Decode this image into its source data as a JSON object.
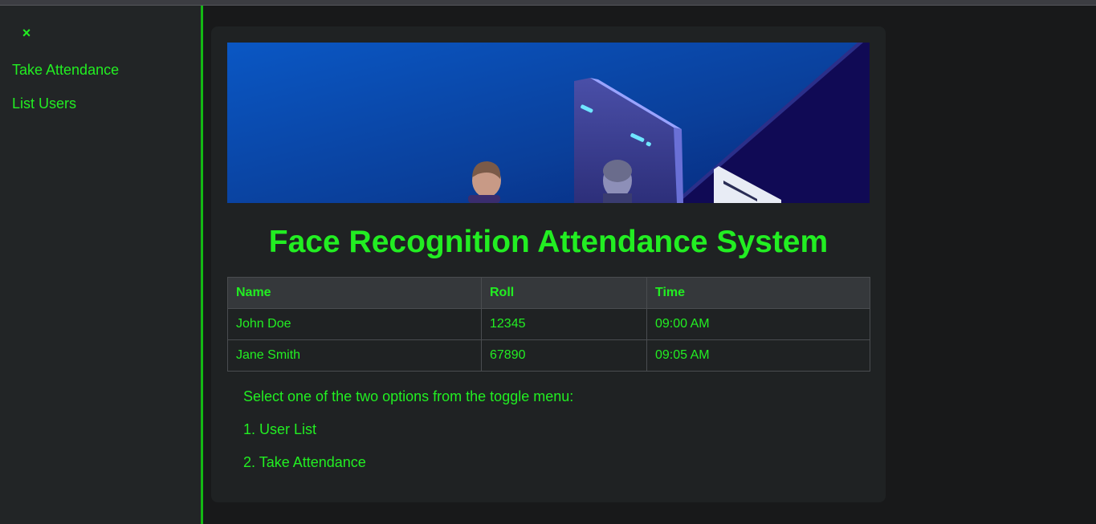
{
  "sidebar": {
    "close_label": "×",
    "items": [
      {
        "label": "Take Attendance"
      },
      {
        "label": "List Users"
      }
    ]
  },
  "main": {
    "title": "Face Recognition Attendance System",
    "table": {
      "headers": [
        "Name",
        "Roll",
        "Time"
      ],
      "rows": [
        [
          "John Doe",
          "12345",
          "09:00 AM"
        ],
        [
          "Jane Smith",
          "67890",
          "09:05 AM"
        ]
      ]
    },
    "instructions": {
      "intro": "Select one of the two options from the toggle menu:",
      "options": [
        "1. User List",
        "2. Take Attendance"
      ]
    }
  },
  "colors": {
    "accent": "#22ee22",
    "sidebar_border": "#14b814",
    "background": "#18191a",
    "card": "#1f2223"
  },
  "icons": {
    "close": "close-icon",
    "banner": "face-recognition-banner-illustration"
  }
}
